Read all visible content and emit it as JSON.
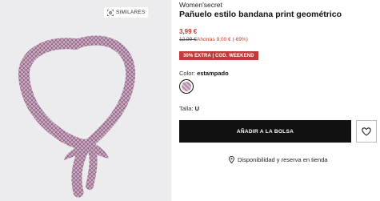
{
  "image": {
    "similares_label": "SIMILARES",
    "background_color": "#ecebee",
    "scarf_color": "#b58aa9"
  },
  "product": {
    "brand": "Women'secret",
    "title": "Pañuelo estilo bandana print geométrico",
    "price": "3,99 €",
    "old_price": "12,99 €",
    "now_price": "Ahorras 9,00 € (-69%)",
    "promo": "30% EXTRA | COD. WEEKEND",
    "color_prefix": "Color: ",
    "color_value": "estampado",
    "size_prefix": "Talla: ",
    "size_value": "U"
  },
  "actions": {
    "add_to_bag": "AÑADIR A LA BOLSA",
    "store_availability": "Disponibilidad y reserva en tienda",
    "wishlist_icon": "heart-icon",
    "store_icon": "location-pin-icon"
  },
  "colors": {
    "price_red": "#c0392b",
    "promo_bg": "#c23b3b",
    "button_bg": "#111111"
  }
}
